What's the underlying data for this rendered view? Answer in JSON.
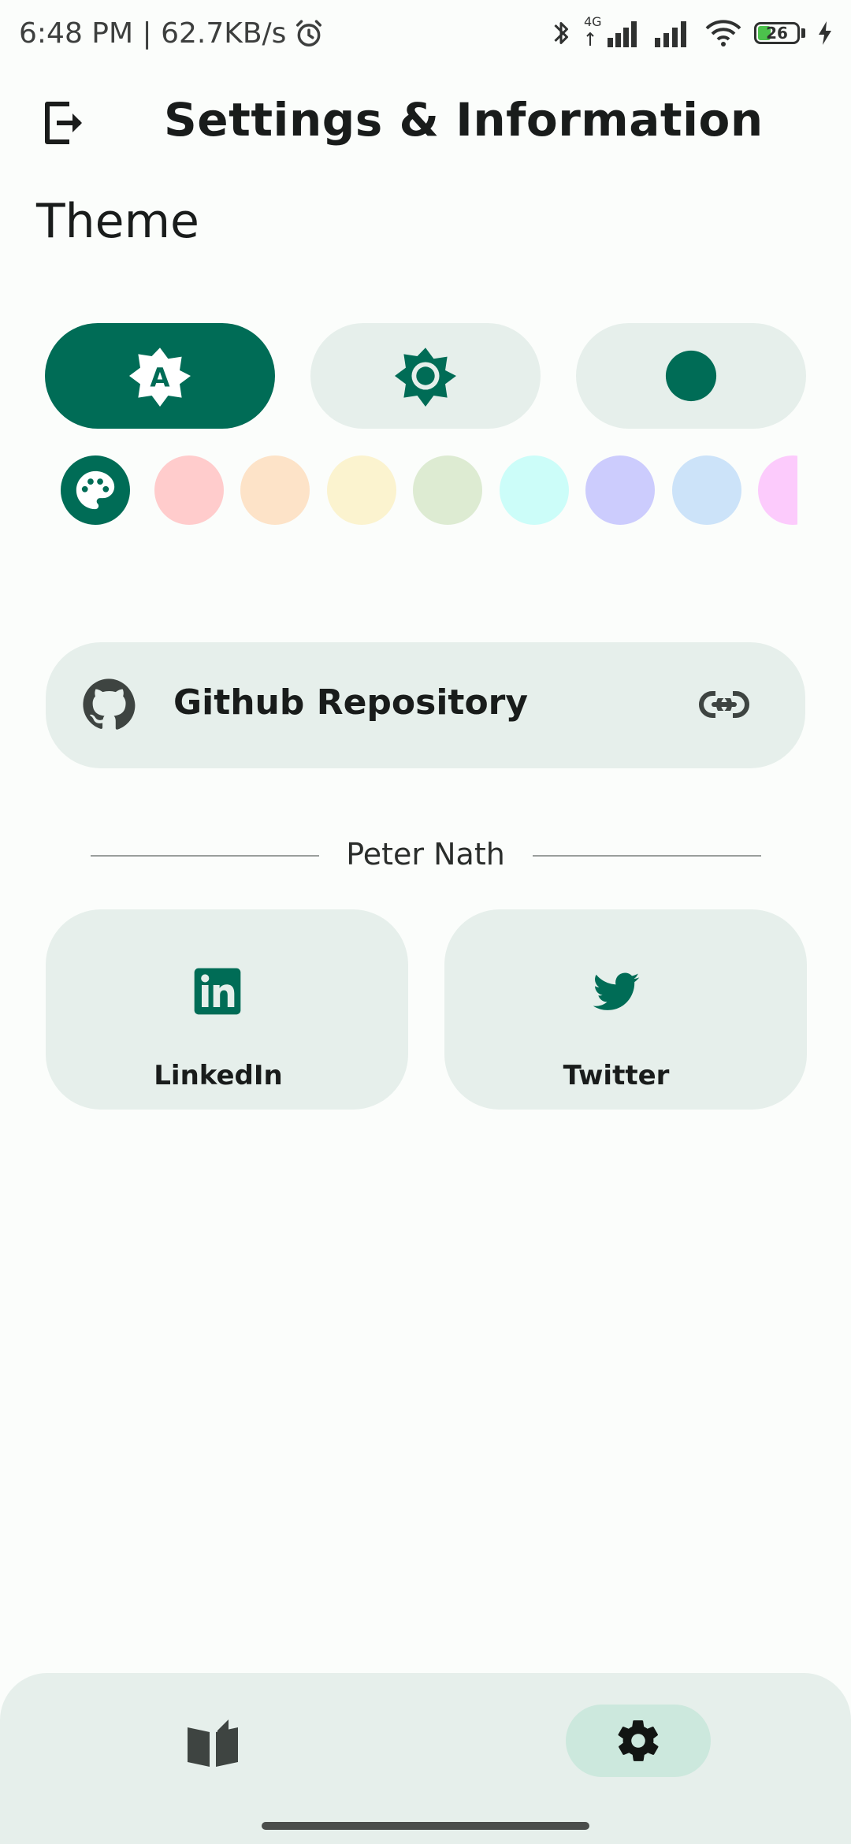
{
  "status_bar": {
    "left_text": "6:48 PM | 62.7KB/s",
    "network_label": "4G",
    "battery_level": "26"
  },
  "header": {
    "title": "Settings & Information"
  },
  "theme": {
    "heading": "Theme",
    "modes": [
      {
        "name": "auto",
        "icon": "brightness-auto-icon",
        "selected": true
      },
      {
        "name": "light",
        "icon": "light-mode-icon",
        "selected": false
      },
      {
        "name": "dark",
        "icon": "dark-mode-icon",
        "selected": false
      }
    ],
    "colors": [
      "#ffcccc",
      "#fde3c8",
      "#fbf3cf",
      "#ddebd2",
      "#ccfdf9",
      "#ccccfd",
      "#cce3f9",
      "#fccbfc"
    ],
    "accent": "#006c56"
  },
  "github": {
    "label": "Github Repository"
  },
  "author": {
    "name": "Peter Nath"
  },
  "social": {
    "linkedin_label": "LinkedIn",
    "twitter_label": "Twitter"
  },
  "bottom_nav": {
    "items": [
      {
        "name": "library",
        "icon": "book-icon",
        "selected": false
      },
      {
        "name": "settings",
        "icon": "gear-icon",
        "selected": true
      }
    ]
  }
}
